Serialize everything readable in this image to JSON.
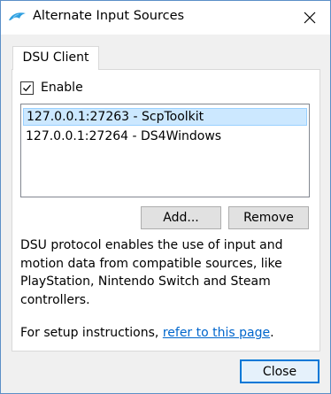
{
  "window": {
    "title": "Alternate Input Sources",
    "accent": "#0078d7"
  },
  "tabs": [
    {
      "label": "DSU Client",
      "selected": true
    }
  ],
  "enable": {
    "label": "Enable",
    "checked": true
  },
  "servers": [
    {
      "text": "127.0.0.1:27263 - ScpToolkit",
      "selected": true
    },
    {
      "text": "127.0.0.1:27264 - DS4Windows",
      "selected": false
    }
  ],
  "buttons": {
    "add": "Add...",
    "remove": "Remove",
    "close": "Close"
  },
  "description": "DSU protocol enables the use of input and motion data from compatible sources, like PlayStation, Nintendo Switch and Steam controllers.",
  "setup": {
    "prefix": "For setup instructions, ",
    "link_text": "refer to this page",
    "suffix": "."
  }
}
